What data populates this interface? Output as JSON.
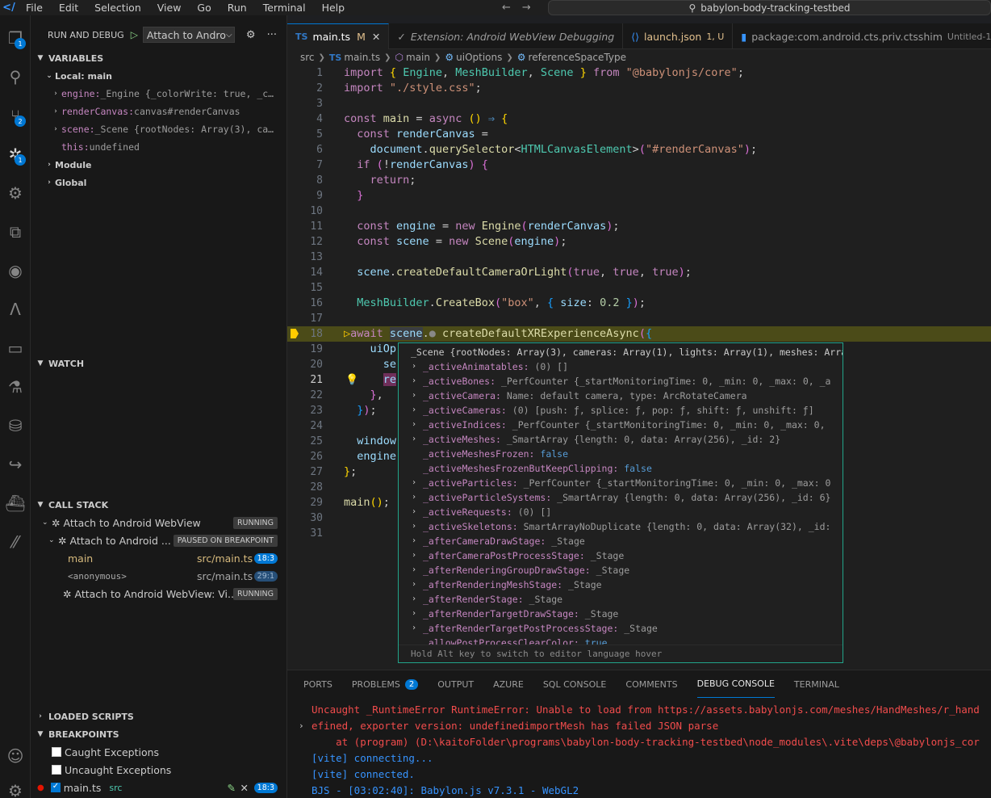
{
  "titlebar": {
    "menu": [
      "File",
      "Edit",
      "Selection",
      "View",
      "Go",
      "Run",
      "Terminal",
      "Help"
    ],
    "search": "babylon-body-tracking-testbed"
  },
  "activity": {
    "explorer_badge": "1",
    "scm_badge": "2",
    "debug_badge": "1"
  },
  "sidebar": {
    "title": "RUN AND DEBUG",
    "config": "Attach to Andro",
    "variables": {
      "header": "VARIABLES",
      "scope": "Local: main",
      "items": [
        {
          "name": "engine:",
          "value": " _Engine {_colorWrite: true, _c…"
        },
        {
          "name": "renderCanvas:",
          "value": " canvas#renderCanvas"
        },
        {
          "name": "scene:",
          "value": " _Scene {rootNodes: Array(3), ca…"
        },
        {
          "name": "this:",
          "value": " undefined"
        }
      ],
      "module": "Module",
      "global": "Global"
    },
    "watch": "WATCH",
    "callstack": {
      "header": "CALL STACK",
      "items": [
        {
          "label": "Attach to Android WebView",
          "tag": "RUNNING"
        },
        {
          "label": "Attach to Android ...",
          "tag": "PAUSED ON BREAKPOINT"
        }
      ],
      "frames": [
        {
          "name": "main",
          "loc": "src/main.ts",
          "pos": "18:3"
        },
        {
          "name": "<anonymous>",
          "loc": "src/main.ts",
          "pos": "29:1"
        }
      ],
      "last": {
        "label": "Attach to Android WebView: Vi...",
        "tag": "RUNNING"
      }
    },
    "loaded_scripts": "LOADED SCRIPTS",
    "breakpoints": {
      "header": "BREAKPOINTS",
      "caught": "Caught Exceptions",
      "uncaught": "Uncaught Exceptions",
      "file": "main.ts",
      "folder": "src",
      "pos": "18:3"
    }
  },
  "tabs": [
    {
      "icon": "TS",
      "label": "main.ts",
      "status": "M"
    },
    {
      "label": "Extension: Android WebView Debugging"
    },
    {
      "label": "launch.json",
      "status": "1, U"
    },
    {
      "label": "package:com.android.cts.priv.ctsshim",
      "status": "Untitled-1"
    }
  ],
  "breadcrumb": [
    "src",
    "main.ts",
    "main",
    "uiOptions",
    "referenceSpaceType"
  ],
  "code_lines": [
    "1",
    "2",
    "3",
    "4",
    "5",
    "6",
    "7",
    "8",
    "9",
    "10",
    "11",
    "12",
    "13",
    "14",
    "15",
    "16",
    "17",
    "18",
    "19",
    "20",
    "21",
    "22",
    "23",
    "24",
    "25",
    "26",
    "27",
    "28",
    "29",
    "30",
    "31"
  ],
  "hover": {
    "header": "_Scene {rootNodes: Array(3), cameras: Array(1), lights: Array(1), meshes: Array…",
    "rows": [
      {
        "exp": true,
        "key": "_activeAnimatables:",
        "val": " (0) []"
      },
      {
        "exp": true,
        "key": "_activeBones:",
        "val": " _PerfCounter {_startMonitoringTime: 0, _min: 0, _max: 0, _a"
      },
      {
        "exp": true,
        "key": "_activeCamera:",
        "val": " Name: default camera, type: ArcRotateCamera"
      },
      {
        "exp": true,
        "key": "_activeCameras:",
        "val": " (0) [push: ƒ, splice: ƒ, pop: ƒ, shift: ƒ, unshift: ƒ]"
      },
      {
        "exp": true,
        "key": "_activeIndices:",
        "val": " _PerfCounter {_startMonitoringTime: 0, _min: 0, _max: 0,"
      },
      {
        "exp": true,
        "key": "_activeMeshes:",
        "val": " _SmartArray {length: 0, data: Array(256), _id: 2}"
      },
      {
        "exp": false,
        "key": "_activeMeshesFrozen:",
        "bool": " false"
      },
      {
        "exp": false,
        "key": "_activeMeshesFrozenButKeepClipping:",
        "bool": " false"
      },
      {
        "exp": true,
        "key": "_activeParticles:",
        "val": " _PerfCounter {_startMonitoringTime: 0, _min: 0, _max: 0"
      },
      {
        "exp": true,
        "key": "_activeParticleSystems:",
        "val": " _SmartArray {length: 0, data: Array(256), _id: 6}"
      },
      {
        "exp": true,
        "key": "_activeRequests:",
        "val": " (0) []"
      },
      {
        "exp": true,
        "key": "_activeSkeletons:",
        "val": " SmartArrayNoDuplicate {length: 0, data: Array(32), _id:"
      },
      {
        "exp": true,
        "key": "_afterCameraDrawStage:",
        "val": " _Stage"
      },
      {
        "exp": true,
        "key": "_afterCameraPostProcessStage:",
        "val": " _Stage"
      },
      {
        "exp": true,
        "key": "_afterRenderingGroupDrawStage:",
        "val": " _Stage"
      },
      {
        "exp": true,
        "key": "_afterRenderingMeshStage:",
        "val": " _Stage"
      },
      {
        "exp": true,
        "key": "_afterRenderStage:",
        "val": " _Stage"
      },
      {
        "exp": true,
        "key": "_afterRenderTargetDrawStage:",
        "val": " _Stage"
      },
      {
        "exp": true,
        "key": "_afterRenderTargetPostProcessStage:",
        "val": " _Stage"
      },
      {
        "exp": false,
        "key": "_allowPostProcessClearColor:",
        "bool": " true"
      }
    ],
    "footer": "Hold Alt key to switch to editor language hover"
  },
  "panel": {
    "tabs": [
      "PORTS",
      "PROBLEMS",
      "OUTPUT",
      "AZURE",
      "SQL CONSOLE",
      "COMMENTS",
      "DEBUG CONSOLE",
      "TERMINAL"
    ],
    "problems_count": "2",
    "lines": [
      "Uncaught _RuntimeError RuntimeError: Unable to load from https://assets.babylonjs.com/meshes/HandMeshes/r_hand",
      "efined, exporter version: undefinedimportMesh has failed JSON parse",
      "    at (program) (D:\\kaitoFolder\\programs\\babylon-body-tracking-testbed\\node_modules\\.vite\\deps\\@babylonjs_cor",
      "[vite] connecting...",
      "[vite] connected.",
      "BJS - [03:02:40]: Babylon.js v7.3.1 - WebGL2"
    ]
  }
}
